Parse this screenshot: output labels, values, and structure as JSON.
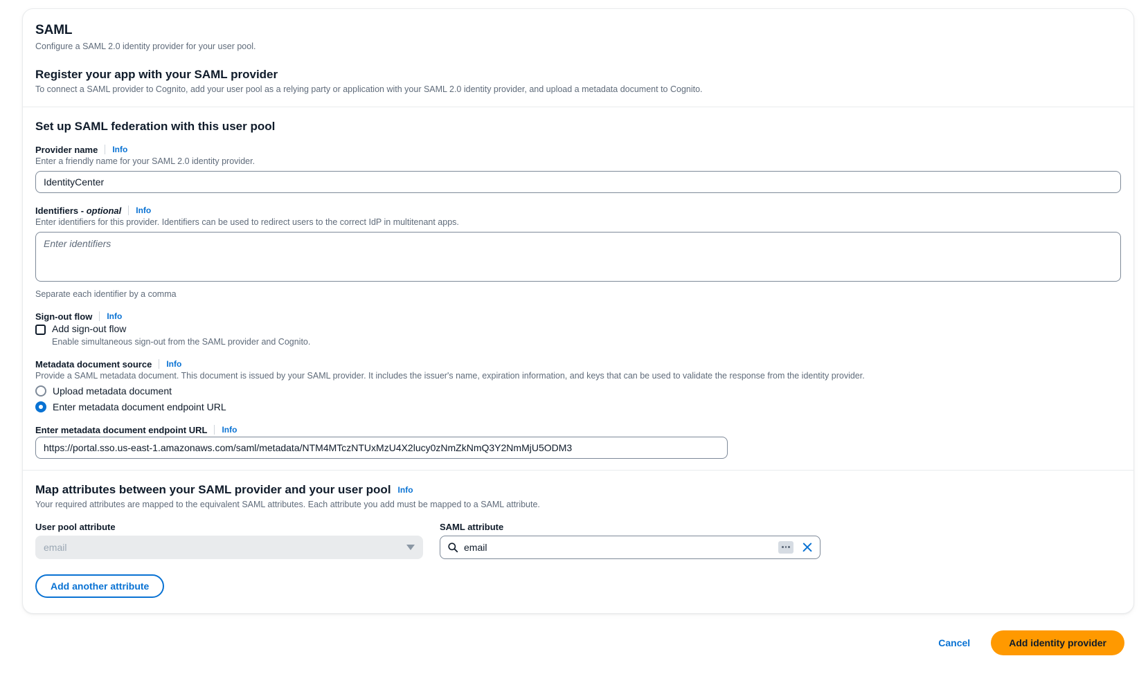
{
  "header": {
    "title": "SAML",
    "description": "Configure a SAML 2.0 identity provider for your user pool."
  },
  "register_section": {
    "title": "Register your app with your SAML provider",
    "description": "To connect a SAML provider to Cognito, add your user pool as a relying party or application with your SAML 2.0 identity provider, and upload a metadata document to Cognito."
  },
  "setup_section": {
    "title": "Set up SAML federation with this user pool",
    "provider_name": {
      "label": "Provider name",
      "info": "Info",
      "hint": "Enter a friendly name for your SAML 2.0 identity provider.",
      "value": "IdentityCenter"
    },
    "identifiers": {
      "label": "Identifiers -",
      "optional": "optional",
      "info": "Info",
      "hint": "Enter identifiers for this provider. Identifiers can be used to redirect users to the correct IdP in multitenant apps.",
      "placeholder": "Enter identifiers",
      "value": "",
      "footnote": "Separate each identifier by a comma"
    },
    "signout_flow": {
      "label": "Sign-out flow",
      "info": "Info",
      "checkbox_label": "Add sign-out flow",
      "checkbox_checked": false,
      "checkbox_hint": "Enable simultaneous sign-out from the SAML provider and Cognito."
    },
    "metadata_source": {
      "label": "Metadata document source",
      "info": "Info",
      "hint": "Provide a SAML metadata document. This document is issued by your SAML provider. It includes the issuer's name, expiration information, and keys that can be used to validate the response from the identity provider.",
      "options": [
        {
          "label": "Upload metadata document",
          "selected": false
        },
        {
          "label": "Enter metadata document endpoint URL",
          "selected": true
        }
      ]
    },
    "endpoint_url": {
      "label": "Enter metadata document endpoint URL",
      "info": "Info",
      "value": "https://portal.sso.us-east-1.amazonaws.com/saml/metadata/NTM4MTczNTUxMzU4X2lucy0zNmZkNmQ3Y2NmMjU5ODM3"
    }
  },
  "map_section": {
    "title": "Map attributes between your SAML provider and your user pool",
    "info": "Info",
    "description": "Your required attributes are mapped to the equivalent SAML attributes. Each attribute you add must be mapped to a SAML attribute.",
    "user_pool_attribute_label": "User pool attribute",
    "saml_attribute_label": "SAML attribute",
    "rows": [
      {
        "user_pool_attribute": "email",
        "saml_attribute": "email"
      }
    ],
    "add_attribute_button": "Add another attribute"
  },
  "footer": {
    "cancel": "Cancel",
    "submit": "Add identity provider"
  },
  "colors": {
    "link": "#0972d3",
    "primary": "#ff9900",
    "text": "#0f1b2a",
    "muted": "#5f6b7a"
  }
}
